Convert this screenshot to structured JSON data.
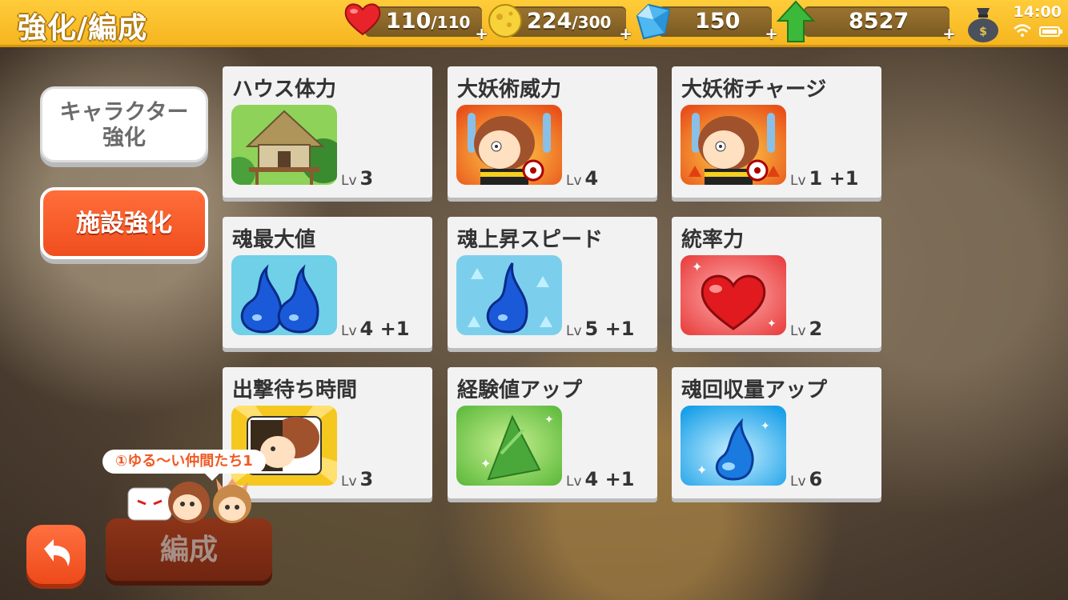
{
  "header": {
    "title": "強化/編成",
    "hp": {
      "value": "110",
      "max": "/110"
    },
    "coins": {
      "value": "224",
      "max": "/300"
    },
    "crystals": {
      "value": "150"
    },
    "points": {
      "value": "8527"
    },
    "plus": "+",
    "time": "14:00"
  },
  "tabs": {
    "character_line1": "キャラクター",
    "character_line2": "強化",
    "facility": "施設強化"
  },
  "cards": [
    {
      "title": "ハウス体力",
      "lv_prefix": "Lv",
      "level": "3"
    },
    {
      "title": "大妖術威力",
      "lv_prefix": "Lv",
      "level": "4"
    },
    {
      "title": "大妖術チャージ",
      "lv_prefix": "Lv",
      "level": "1 +1"
    },
    {
      "title": "魂最大値",
      "lv_prefix": "Lv",
      "level": "4 +1"
    },
    {
      "title": "魂上昇スピード",
      "lv_prefix": "Lv",
      "level": "5 +1"
    },
    {
      "title": "統率力",
      "lv_prefix": "Lv",
      "level": "2"
    },
    {
      "title": "出撃待ち時間",
      "lv_prefix": "Lv",
      "level": "3"
    },
    {
      "title": "経験値アップ",
      "lv_prefix": "Lv",
      "level": "4 +1"
    },
    {
      "title": "魂回収量アップ",
      "lv_prefix": "Lv",
      "level": "6"
    }
  ],
  "party": {
    "label": "①ゆる〜い仲間たち1"
  },
  "buttons": {
    "formation": "編成"
  },
  "icons": {
    "hp": "heart-icon",
    "coins": "coin-icon",
    "crystals": "crystal-icon",
    "points": "green-arrow-icon",
    "bag": "money-bag-icon",
    "back": "back-arrow-icon"
  },
  "colors": {
    "topbar": "#f5b520",
    "accent": "#f04e1e",
    "card": "#f2f2f2"
  }
}
